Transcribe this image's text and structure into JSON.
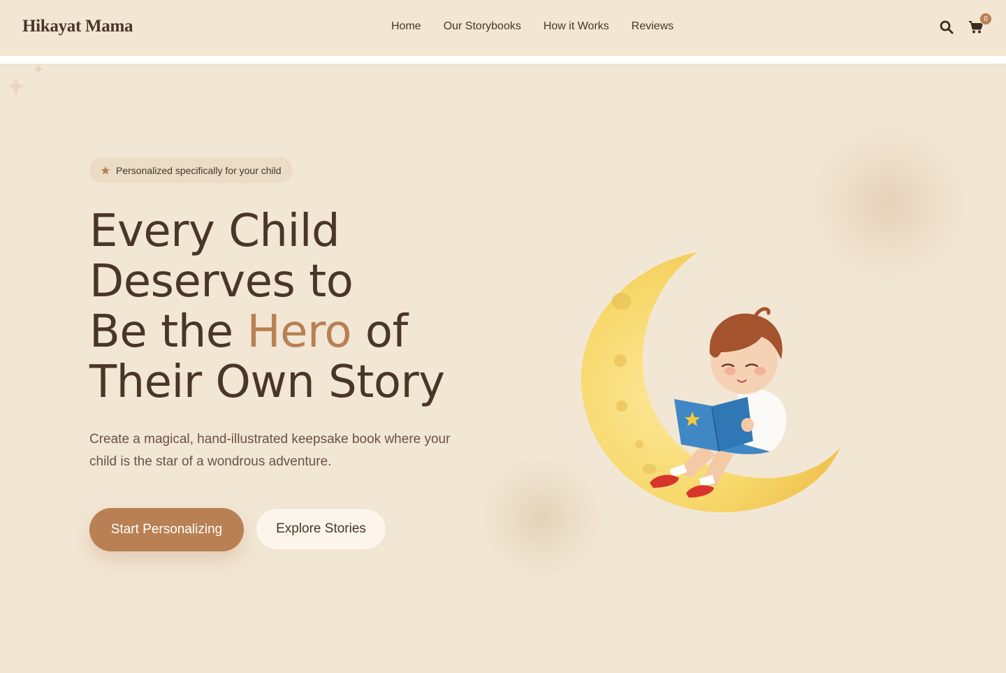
{
  "header": {
    "brand": "Hikayat Mama",
    "nav": [
      {
        "label": "Home"
      },
      {
        "label": "Our Storybooks"
      },
      {
        "label": "How it Works"
      },
      {
        "label": "Reviews"
      }
    ],
    "cart_count": "0",
    "icons": [
      "search-icon",
      "cart-icon"
    ]
  },
  "hero": {
    "badge": "Personalized specifically for your child",
    "headline": {
      "line1": "Every Child",
      "line2": "Deserves to",
      "line3_pre": "Be the ",
      "line3_accent": "Hero",
      "line3_post": " of",
      "line4": "Their Own Story"
    },
    "subtext": "Create a magical, hand-illustrated keepsake book where your child is the star of a wondrous adventure.",
    "cta_primary": "Start Personalizing",
    "cta_secondary": "Explore Stories"
  },
  "colors": {
    "background": "#f2e6d4",
    "text": "#4a3628",
    "accent": "#b88053",
    "moon": "#f7d86a"
  }
}
